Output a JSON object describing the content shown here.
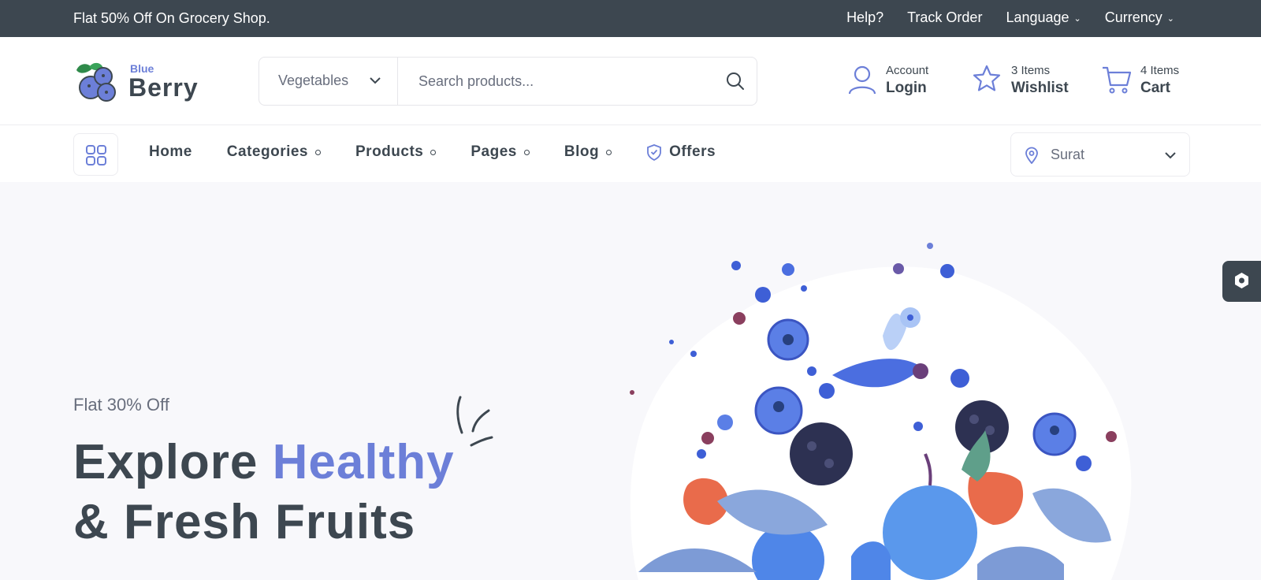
{
  "topbar": {
    "promo": "Flat 50% Off On Grocery Shop.",
    "help": "Help?",
    "track_order": "Track Order",
    "language": "Language",
    "currency": "Currency"
  },
  "logo": {
    "line1": "Blue",
    "line2": "Berry"
  },
  "search": {
    "category": "Vegetables",
    "placeholder": "Search products..."
  },
  "header": {
    "account": {
      "small": "Account",
      "big": "Login"
    },
    "wishlist": {
      "small": "3 Items",
      "big": "Wishlist"
    },
    "cart": {
      "small": "4 Items",
      "big": "Cart"
    }
  },
  "nav": {
    "items": [
      {
        "label": "Home"
      },
      {
        "label": "Categories"
      },
      {
        "label": "Products"
      },
      {
        "label": "Pages"
      },
      {
        "label": "Blog"
      },
      {
        "label": "Offers"
      }
    ],
    "location": "Surat"
  },
  "hero": {
    "subtitle": "Flat 30% Off",
    "title_part1": "Explore ",
    "title_accent": "Healthy",
    "title_line2": "& Fresh Fruits"
  },
  "colors": {
    "accent": "#6c7fd8",
    "dark": "#3d4750",
    "muted": "#686e7d"
  },
  "icons": [
    "chevron-down-icon",
    "search-icon",
    "user-icon",
    "star-icon",
    "cart-icon",
    "grid-icon",
    "shield-icon",
    "location-pin-icon",
    "settings-hex-icon"
  ]
}
